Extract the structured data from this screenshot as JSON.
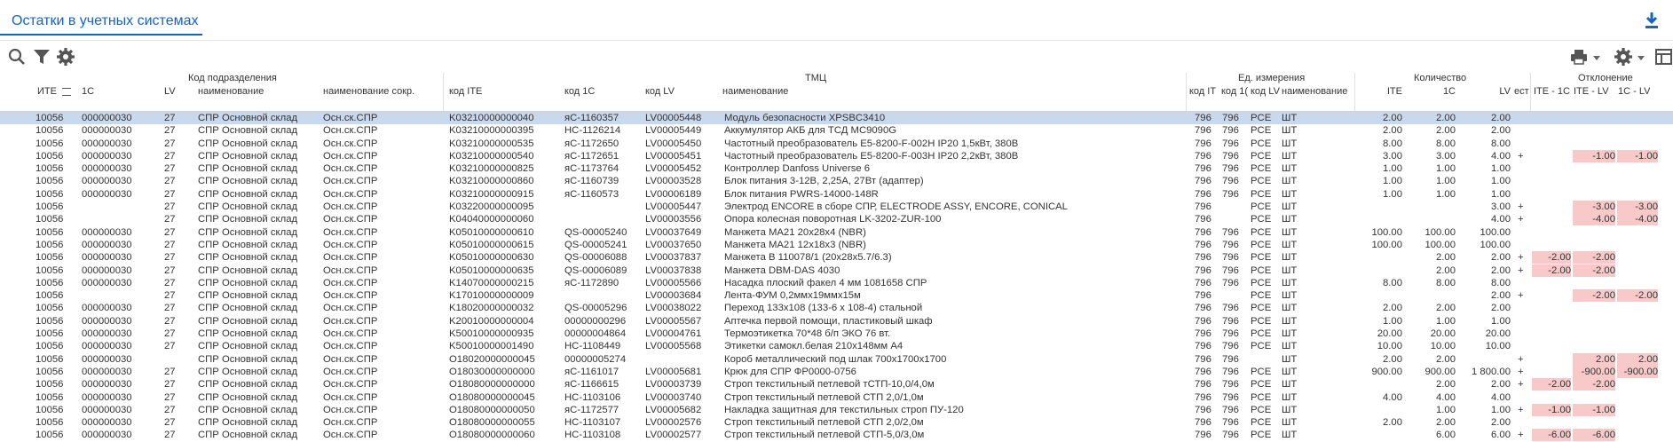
{
  "title": "Остатки в учетных системах",
  "icons": {
    "download": "download-icon",
    "search": "search-icon",
    "filter": "filter-icon",
    "settings": "gear-icon",
    "print": "print-icon",
    "settings_right": "gear-icon",
    "columns": "table-icon"
  },
  "colors": {
    "accent": "#1565c0",
    "selected_row": "#c8d9ee",
    "deviation": "#f8c9c9"
  },
  "groups": {
    "subdivision": "Код подразделения",
    "tmc": "ТМЦ",
    "unit": "Ед. измерения",
    "qty": "Количество",
    "dev": "Отклонение"
  },
  "columns": {
    "ite": "ИТЕ",
    "c1": "1С",
    "lv": "LV",
    "name": "наименование",
    "short": "наименование сокр.",
    "code_ite": "код ITE",
    "code_1c": "код 1С",
    "code_lv": "код LV",
    "tmc_name": "наименование",
    "u_ite": "код IT",
    "u_1c": "код 1(",
    "u_lv": "код LV",
    "u_name": "наименование",
    "q_ite": "ITE",
    "q_1c": "1С",
    "q_lv": "LV",
    "q_est": "ест",
    "d1": "ITE - 1С",
    "d2": "ITE - LV",
    "d3": "1С - LV"
  },
  "rows": [
    {
      "ite": "10056",
      "c1": "000000030",
      "lv": "27",
      "name": "СПР Основной склад",
      "short": "Осн.ск.СПР",
      "code_ite": "K03210000000040",
      "code_1c": "яС-1160357",
      "code_lv": "LV00005448",
      "tmc": "Модуль безопасности XPSBC3410",
      "u_ite": "796",
      "u_1c": "796",
      "u_lv": "PCE",
      "u_name": "ШТ",
      "q_ite": "2.00",
      "q_1c": "2.00",
      "q_lv": "2.00",
      "est": "",
      "d1": "",
      "d2": "",
      "d3": ""
    },
    {
      "ite": "10056",
      "c1": "000000030",
      "lv": "27",
      "name": "СПР Основной склад",
      "short": "Осн.ск.СПР",
      "code_ite": "K03210000000395",
      "code_1c": "НС-1126214",
      "code_lv": "LV00005449",
      "tmc": "Аккумулятор АКБ для ТСД MC9090G",
      "u_ite": "796",
      "u_1c": "796",
      "u_lv": "PCE",
      "u_name": "ШТ",
      "q_ite": "2.00",
      "q_1c": "2.00",
      "q_lv": "2.00",
      "est": "",
      "d1": "",
      "d2": "",
      "d3": ""
    },
    {
      "ite": "10056",
      "c1": "000000030",
      "lv": "27",
      "name": "СПР Основной склад",
      "short": "Осн.ск.СПР",
      "code_ite": "K03210000000535",
      "code_1c": "яС-1172650",
      "code_lv": "LV00005450",
      "tmc": "Частотный преобразователь E5-8200-F-002H IP20 1,5кВт, 380В",
      "u_ite": "796",
      "u_1c": "796",
      "u_lv": "PCE",
      "u_name": "ШТ",
      "q_ite": "8.00",
      "q_1c": "8.00",
      "q_lv": "8.00",
      "est": "",
      "d1": "",
      "d2": "",
      "d3": ""
    },
    {
      "ite": "10056",
      "c1": "000000030",
      "lv": "27",
      "name": "СПР Основной склад",
      "short": "Осн.ск.СПР",
      "code_ite": "K03210000000540",
      "code_1c": "яС-1172651",
      "code_lv": "LV00005451",
      "tmc": "Частотный преобразователь E5-8200-F-003H IP20 2,2кВт, 380В",
      "u_ite": "796",
      "u_1c": "796",
      "u_lv": "PCE",
      "u_name": "ШТ",
      "q_ite": "3.00",
      "q_1c": "3.00",
      "q_lv": "4.00",
      "est": "+",
      "d1": "",
      "d2": "-1.00",
      "d3": "-1.00"
    },
    {
      "ite": "10056",
      "c1": "000000030",
      "lv": "27",
      "name": "СПР Основной склад",
      "short": "Осн.ск.СПР",
      "code_ite": "K03210000000825",
      "code_1c": "яС-1173764",
      "code_lv": "LV00005452",
      "tmc": "Контроллер Danfoss Universe 6",
      "u_ite": "796",
      "u_1c": "796",
      "u_lv": "PCE",
      "u_name": "ШТ",
      "q_ite": "1.00",
      "q_1c": "1.00",
      "q_lv": "1.00",
      "est": "",
      "d1": "",
      "d2": "",
      "d3": ""
    },
    {
      "ite": "10056",
      "c1": "000000030",
      "lv": "27",
      "name": "СПР Основной склад",
      "short": "Осн.ск.СПР",
      "code_ite": "K03210000000860",
      "code_1c": "яС-1160739",
      "code_lv": "LV00003528",
      "tmc": "Блок питания 3-12В, 2,25А, 27Вт (адаптер)",
      "u_ite": "796",
      "u_1c": "796",
      "u_lv": "PCE",
      "u_name": "ШТ",
      "q_ite": "1.00",
      "q_1c": "1.00",
      "q_lv": "1.00",
      "est": "",
      "d1": "",
      "d2": "",
      "d3": ""
    },
    {
      "ite": "10056",
      "c1": "000000030",
      "lv": "27",
      "name": "СПР Основной склад",
      "short": "Осн.ск.СПР",
      "code_ite": "K03210000000915",
      "code_1c": "яС-1160573",
      "code_lv": "LV00006189",
      "tmc": "Блок питания PWRS-14000-148R",
      "u_ite": "796",
      "u_1c": "796",
      "u_lv": "PCE",
      "u_name": "ШТ",
      "q_ite": "1.00",
      "q_1c": "1.00",
      "q_lv": "1.00",
      "est": "",
      "d1": "",
      "d2": "",
      "d3": ""
    },
    {
      "ite": "10056",
      "c1": "",
      "lv": "27",
      "name": "СПР Основной склад",
      "short": "Осн.ск.СПР",
      "code_ite": "K03220000000095",
      "code_1c": "",
      "code_lv": "LV00005447",
      "tmc": "Электрод ENCORE в сборе СПР, ELECTRODE ASSY, ENCORE, CONICAL",
      "u_ite": "796",
      "u_1c": "",
      "u_lv": "PCE",
      "u_name": "ШТ",
      "q_ite": "",
      "q_1c": "",
      "q_lv": "3.00",
      "est": "+",
      "d1": "",
      "d2": "-3.00",
      "d3": "-3.00"
    },
    {
      "ite": "10056",
      "c1": "",
      "lv": "27",
      "name": "СПР Основной склад",
      "short": "Осн.ск.СПР",
      "code_ite": "K04040000000060",
      "code_1c": "",
      "code_lv": "LV00003556",
      "tmc": "Опора колесная поворотная LK-3202-ZUR-100",
      "u_ite": "796",
      "u_1c": "",
      "u_lv": "PCE",
      "u_name": "ШТ",
      "q_ite": "",
      "q_1c": "",
      "q_lv": "4.00",
      "est": "+",
      "d1": "",
      "d2": "-4.00",
      "d3": "-4.00"
    },
    {
      "ite": "10056",
      "c1": "000000030",
      "lv": "27",
      "name": "СПР Основной склад",
      "short": "Осн.ск.СПР",
      "code_ite": "K05010000000610",
      "code_1c": "QS-00005240",
      "code_lv": "LV00037649",
      "tmc": "Манжета MA21 20x28x4 (NBR)",
      "u_ite": "796",
      "u_1c": "796",
      "u_lv": "PCE",
      "u_name": "ШТ",
      "q_ite": "100.00",
      "q_1c": "100.00",
      "q_lv": "100.00",
      "est": "",
      "d1": "",
      "d2": "",
      "d3": ""
    },
    {
      "ite": "10056",
      "c1": "000000030",
      "lv": "27",
      "name": "СПР Основной склад",
      "short": "Осн.ск.СПР",
      "code_ite": "K05010000000615",
      "code_1c": "QS-00005241",
      "code_lv": "LV00037650",
      "tmc": "Манжета MA21 12x18x3 (NBR)",
      "u_ite": "796",
      "u_1c": "796",
      "u_lv": "PCE",
      "u_name": "ШТ",
      "q_ite": "100.00",
      "q_1c": "100.00",
      "q_lv": "100.00",
      "est": "",
      "d1": "",
      "d2": "",
      "d3": ""
    },
    {
      "ite": "10056",
      "c1": "000000030",
      "lv": "27",
      "name": "СПР Основной склад",
      "short": "Осн.ск.СПР",
      "code_ite": "K05010000000630",
      "code_1c": "QS-00006088",
      "code_lv": "LV00037837",
      "tmc": "Манжета В 110078/1 (20x28x5.7/6.3)",
      "u_ite": "796",
      "u_1c": "796",
      "u_lv": "PCE",
      "u_name": "ШТ",
      "q_ite": "",
      "q_1c": "2.00",
      "q_lv": "2.00",
      "est": "+",
      "d1": "-2.00",
      "d2": "-2.00",
      "d3": ""
    },
    {
      "ite": "10056",
      "c1": "000000030",
      "lv": "27",
      "name": "СПР Основной склад",
      "short": "Осн.ск.СПР",
      "code_ite": "K05010000000635",
      "code_1c": "QS-00006089",
      "code_lv": "LV00037838",
      "tmc": "Манжета DBM-DAS 4030",
      "u_ite": "796",
      "u_1c": "796",
      "u_lv": "PCE",
      "u_name": "ШТ",
      "q_ite": "",
      "q_1c": "2.00",
      "q_lv": "2.00",
      "est": "+",
      "d1": "-2.00",
      "d2": "-2.00",
      "d3": ""
    },
    {
      "ite": "10056",
      "c1": "000000030",
      "lv": "27",
      "name": "СПР Основной склад",
      "short": "Осн.ск.СПР",
      "code_ite": "K14070000000215",
      "code_1c": "яС-1172890",
      "code_lv": "LV00005566",
      "tmc": "Насадка плоский факел 4 мм 1081658 СПР",
      "u_ite": "796",
      "u_1c": "796",
      "u_lv": "PCE",
      "u_name": "ШТ",
      "q_ite": "8.00",
      "q_1c": "8.00",
      "q_lv": "8.00",
      "est": "",
      "d1": "",
      "d2": "",
      "d3": ""
    },
    {
      "ite": "10056",
      "c1": "",
      "lv": "27",
      "name": "СПР Основной склад",
      "short": "Осн.ск.СПР",
      "code_ite": "K17010000000009",
      "code_1c": "",
      "code_lv": "LV00003684",
      "tmc": "Лента-ФУМ 0,2ммx19ммx15м",
      "u_ite": "796",
      "u_1c": "",
      "u_lv": "PCE",
      "u_name": "ШТ",
      "q_ite": "",
      "q_1c": "",
      "q_lv": "2.00",
      "est": "+",
      "d1": "",
      "d2": "-2.00",
      "d3": "-2.00"
    },
    {
      "ite": "10056",
      "c1": "000000030",
      "lv": "27",
      "name": "СПР Основной склад",
      "short": "Осн.ск.СПР",
      "code_ite": "K18020000000032",
      "code_1c": "QS-00005296",
      "code_lv": "LV00038022",
      "tmc": "Переход 133x108 (133-6 x 108-4) стальной",
      "u_ite": "796",
      "u_1c": "796",
      "u_lv": "PCE",
      "u_name": "ШТ",
      "q_ite": "2.00",
      "q_1c": "2.00",
      "q_lv": "2.00",
      "est": "",
      "d1": "",
      "d2": "",
      "d3": ""
    },
    {
      "ite": "10056",
      "c1": "000000030",
      "lv": "27",
      "name": "СПР Основной склад",
      "short": "Осн.ск.СПР",
      "code_ite": "K20010000000004",
      "code_1c": "00000000296",
      "code_lv": "LV00005567",
      "tmc": "Аптечка первой помощи, пластиковый шкаф",
      "u_ite": "796",
      "u_1c": "796",
      "u_lv": "PCE",
      "u_name": "ШТ",
      "q_ite": "1.00",
      "q_1c": "1.00",
      "q_lv": "1.00",
      "est": "",
      "d1": "",
      "d2": "",
      "d3": ""
    },
    {
      "ite": "10056",
      "c1": "000000030",
      "lv": "27",
      "name": "СПР Основной склад",
      "short": "Осн.ск.СПР",
      "code_ite": "K50010000000935",
      "code_1c": "00000004864",
      "code_lv": "LV00004761",
      "tmc": "Термоэтикетка 70*48 б/п ЭКО 76 вт.",
      "u_ite": "796",
      "u_1c": "796",
      "u_lv": "PCE",
      "u_name": "ШТ",
      "q_ite": "20.00",
      "q_1c": "20.00",
      "q_lv": "20.00",
      "est": "",
      "d1": "",
      "d2": "",
      "d3": ""
    },
    {
      "ite": "10056",
      "c1": "000000030",
      "lv": "27",
      "name": "СПР Основной склад",
      "short": "Осн.ск.СПР",
      "code_ite": "K50010000001490",
      "code_1c": "НС-1108449",
      "code_lv": "LV00005568",
      "tmc": "Этикетки самокл.белая 210x148мм А4",
      "u_ite": "796",
      "u_1c": "796",
      "u_lv": "PCE",
      "u_name": "ШТ",
      "q_ite": "10.00",
      "q_1c": "10.00",
      "q_lv": "10.00",
      "est": "",
      "d1": "",
      "d2": "",
      "d3": ""
    },
    {
      "ite": "10056",
      "c1": "000000030",
      "lv": "",
      "name": "СПР Основной склад",
      "short": "Осн.ск.СПР",
      "code_ite": "O18020000000045",
      "code_1c": "00000005274",
      "code_lv": "",
      "tmc": "Короб металлический под шлак 700x1700x1700",
      "u_ite": "796",
      "u_1c": "796",
      "u_lv": "",
      "u_name": "ШТ",
      "q_ite": "2.00",
      "q_1c": "2.00",
      "q_lv": "",
      "est": "+",
      "d1": "",
      "d2": "2.00",
      "d3": "2.00"
    },
    {
      "ite": "10056",
      "c1": "000000030",
      "lv": "27",
      "name": "СПР Основной склад",
      "short": "Осн.ск.СПР",
      "code_ite": "O18030000000000",
      "code_1c": "яС-1161017",
      "code_lv": "LV00005681",
      "tmc": "Крюк для СПР ФР0000-0756",
      "u_ite": "796",
      "u_1c": "796",
      "u_lv": "PCE",
      "u_name": "ШТ",
      "q_ite": "900.00",
      "q_1c": "900.00",
      "q_lv": "1 800.00",
      "est": "+",
      "d1": "",
      "d2": "-900.00",
      "d3": "-900.00"
    },
    {
      "ite": "10056",
      "c1": "000000030",
      "lv": "27",
      "name": "СПР Основной склад",
      "short": "Осн.ск.СПР",
      "code_ite": "O18080000000000",
      "code_1c": "яС-1166615",
      "code_lv": "LV00003739",
      "tmc": "Строп текстильный петлевой тСТП-10,0/4,0м",
      "u_ite": "796",
      "u_1c": "796",
      "u_lv": "PCE",
      "u_name": "ШТ",
      "q_ite": "",
      "q_1c": "2.00",
      "q_lv": "2.00",
      "est": "+",
      "d1": "-2.00",
      "d2": "-2.00",
      "d3": ""
    },
    {
      "ite": "10056",
      "c1": "000000030",
      "lv": "27",
      "name": "СПР Основной склад",
      "short": "Осн.ск.СПР",
      "code_ite": "O18080000000045",
      "code_1c": "НС-1103106",
      "code_lv": "LV00003740",
      "tmc": "Строп текстильный петлевой СТП 2,0/1,0м",
      "u_ite": "796",
      "u_1c": "796",
      "u_lv": "PCE",
      "u_name": "ШТ",
      "q_ite": "4.00",
      "q_1c": "4.00",
      "q_lv": "4.00",
      "est": "",
      "d1": "",
      "d2": "",
      "d3": ""
    },
    {
      "ite": "10056",
      "c1": "000000030",
      "lv": "27",
      "name": "СПР Основной склад",
      "short": "Осн.ск.СПР",
      "code_ite": "O18080000000050",
      "code_1c": "яС-1172577",
      "code_lv": "LV00005682",
      "tmc": "Накладка защитная для текстильных строп ПУ-120",
      "u_ite": "796",
      "u_1c": "796",
      "u_lv": "PCE",
      "u_name": "ШТ",
      "q_ite": "",
      "q_1c": "1.00",
      "q_lv": "1.00",
      "est": "+",
      "d1": "-1.00",
      "d2": "-1.00",
      "d3": ""
    },
    {
      "ite": "10056",
      "c1": "000000030",
      "lv": "27",
      "name": "СПР Основной склад",
      "short": "Осн.ск.СПР",
      "code_ite": "O18080000000055",
      "code_1c": "НС-1103107",
      "code_lv": "LV00002576",
      "tmc": "Строп текстильный петлевой СТП 2,0/2,0м",
      "u_ite": "796",
      "u_1c": "796",
      "u_lv": "PCE",
      "u_name": "ШТ",
      "q_ite": "2.00",
      "q_1c": "2.00",
      "q_lv": "2.00",
      "est": "",
      "d1": "",
      "d2": "",
      "d3": ""
    },
    {
      "ite": "10056",
      "c1": "000000030",
      "lv": "27",
      "name": "СПР Основной склад",
      "short": "Осн.ск.СПР",
      "code_ite": "O18080000000060",
      "code_1c": "НС-1103108",
      "code_lv": "LV00002577",
      "tmc": "Строп текстильный петлевой СТП-5,0/3,0м",
      "u_ite": "796",
      "u_1c": "796",
      "u_lv": "PCE",
      "u_name": "ШТ",
      "q_ite": "",
      "q_1c": "6.00",
      "q_lv": "6.00",
      "est": "+",
      "d1": "-6.00",
      "d2": "-6.00",
      "d3": ""
    }
  ]
}
